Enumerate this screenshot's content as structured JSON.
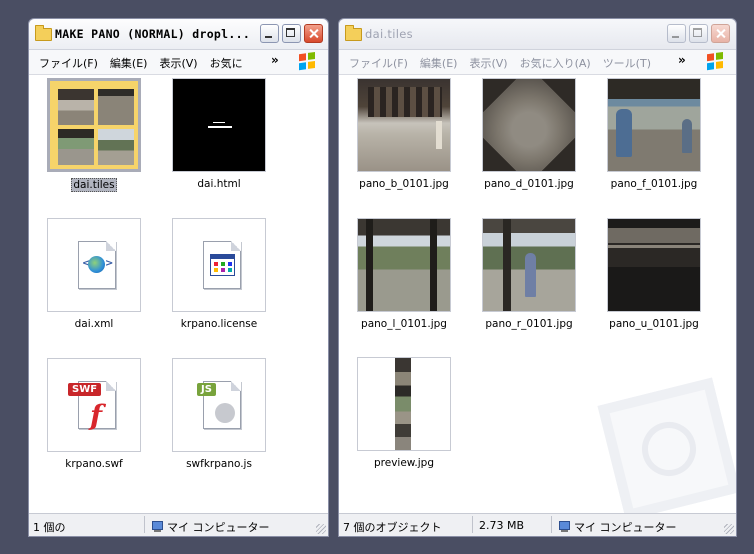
{
  "windows": [
    {
      "title": "MAKE PANO (NORMAL) dropl...",
      "menu": [
        "ファイル(F)",
        "編集(E)",
        "表示(V)",
        "お気に"
      ],
      "files": [
        {
          "name": "dai.tiles",
          "icon": "folder-thumbnail-icon"
        },
        {
          "name": "dai.html",
          "icon": "html-preview-icon"
        },
        {
          "name": "dai.xml",
          "icon": "xml-file-icon"
        },
        {
          "name": "krpano.license",
          "icon": "license-file-icon"
        },
        {
          "name": "krpano.swf",
          "icon": "swf-file-icon"
        },
        {
          "name": "swfkrpano.js",
          "icon": "js-file-icon"
        }
      ],
      "status": {
        "objects": "1 個の",
        "location": "マイ コンピューター"
      }
    },
    {
      "title": "dai.tiles",
      "menu": [
        "ファイル(F)",
        "編集(E)",
        "表示(V)",
        "お気に入り(A)",
        "ツール(T)"
      ],
      "files": [
        {
          "name": "pano_b_0101.jpg",
          "icon": "image-thumbnail"
        },
        {
          "name": "pano_d_0101.jpg",
          "icon": "image-thumbnail"
        },
        {
          "name": "pano_f_0101.jpg",
          "icon": "image-thumbnail"
        },
        {
          "name": "pano_l_0101.jpg",
          "icon": "image-thumbnail"
        },
        {
          "name": "pano_r_0101.jpg",
          "icon": "image-thumbnail"
        },
        {
          "name": "pano_u_0101.jpg",
          "icon": "image-thumbnail"
        },
        {
          "name": "preview.jpg",
          "icon": "image-thumbnail"
        }
      ],
      "status": {
        "objects": "7 個のオブジェクト",
        "size": "2.73 MB",
        "location": "マイ コンピューター"
      }
    }
  ],
  "colors": {
    "desktop": "#4a4e63",
    "close_button": "#d8492c",
    "folder": "#f4cf5a",
    "selection": "#b2b5c0"
  },
  "chevron": "»"
}
